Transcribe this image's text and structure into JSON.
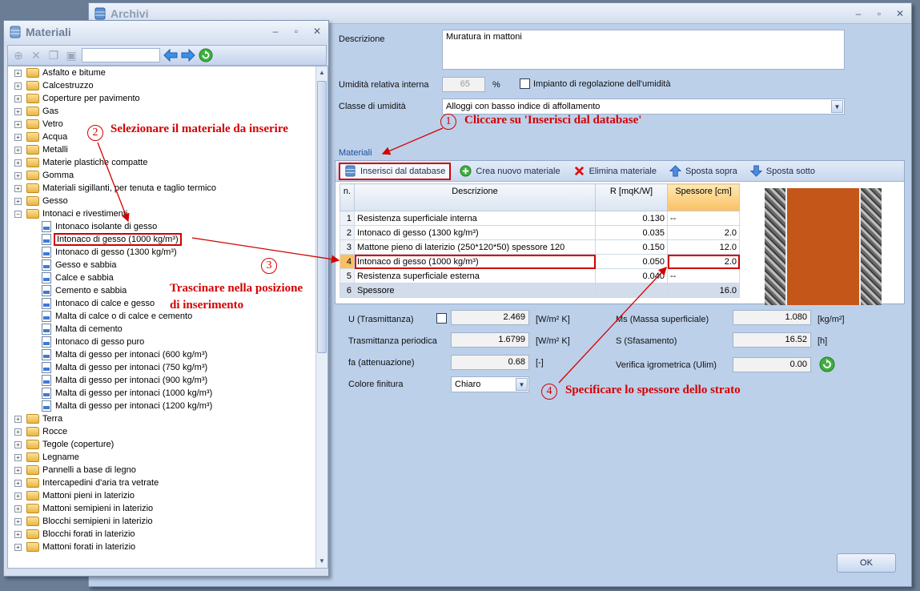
{
  "archivi": {
    "title": "Archivi",
    "descrizione_label": "Descrizione",
    "descrizione_value": "Muratura in mattoni",
    "umidita_label": "Umidità relativa interna",
    "umidita_value": "65",
    "umidita_unit": "%",
    "impianto_label": "Impianto di regolazione dell'umidità",
    "classe_label": "Classe di umidità",
    "classe_value": "Alloggi con basso indice di affollamento",
    "materiali_group": "Materiali",
    "toolbar": {
      "inserisci": "Inserisci dal database",
      "crea": "Crea nuovo materiale",
      "elimina": "Elimina materiale",
      "sopra": "Sposta sopra",
      "sotto": "Sposta sotto"
    },
    "table": {
      "headers": [
        "n.",
        "Descrizione",
        "R [mqK/W]",
        "Spessore [cm]"
      ],
      "rows": [
        {
          "n": "1",
          "desc": "Resistenza superficiale interna",
          "r": "0.130",
          "s": "--"
        },
        {
          "n": "2",
          "desc": "Intonaco di gesso (1300 kg/m³)",
          "r": "0.035",
          "s": "2.0"
        },
        {
          "n": "3",
          "desc": "Mattone pieno di laterizio (250*120*50) spessore 120",
          "r": "0.150",
          "s": "12.0"
        },
        {
          "n": "4",
          "desc": "Intonaco di gesso (1000 kg/m³)",
          "r": "0.050",
          "s": "2.0"
        },
        {
          "n": "5",
          "desc": "Resistenza superficiale esterna",
          "r": "0.040",
          "s": "--"
        }
      ],
      "total": {
        "n": "6",
        "desc": "Spessore",
        "r": "",
        "s": "16.0"
      }
    },
    "results": {
      "u_label": "U (Trasmittanza)",
      "u_value": "2.469",
      "u_unit": "[W/m² K]",
      "tp_label": "Trasmittanza periodica",
      "tp_value": "1.6799",
      "tp_unit": "[W/m² K]",
      "fa_label": "fa (attenuazione)",
      "fa_value": "0.68",
      "fa_unit": "[-]",
      "colore_label": "Colore finitura",
      "colore_value": "Chiaro",
      "ms_label": "Ms (Massa superficiale)",
      "ms_value": "1.080",
      "ms_unit": "[kg/m²]",
      "s_label": "S (Sfasamento)",
      "s_value": "16.52",
      "s_unit": "[h]",
      "verifica_label": "Verifica igrometrica (Ulim)",
      "verifica_value": "0.00"
    },
    "ok": "OK"
  },
  "materiali": {
    "title": "Materiali",
    "tree_top": [
      "Asfalto e bitume",
      "Calcestruzzo",
      "Coperture per pavimento",
      "Gas",
      "Vetro",
      "Acqua",
      "Metalli",
      "Materie plastiche compatte",
      "Gomma",
      "Materiali sigillanti, per tenuta e taglio termico",
      "Gesso",
      "Intonaci e rivestimenti"
    ],
    "tree_children": [
      "Intonaco isolante di gesso",
      "Intonaco di gesso (1000 kg/m³)",
      "Intonaco di gesso (1300 kg/m³)",
      "Gesso e sabbia",
      "Calce e sabbia",
      "Cemento e sabbia",
      "Intonaco di calce e gesso",
      "Malta di calce o di calce e cemento",
      "Malta di cemento",
      "Intonaco di gesso puro",
      "Malta di gesso per intonaci (600 kg/m³)",
      "Malta di gesso per intonaci (750 kg/m³)",
      "Malta di gesso per intonaci (900 kg/m³)",
      "Malta di gesso per intonaci (1000 kg/m³)",
      "Malta di gesso per intonaci (1200 kg/m³)"
    ],
    "tree_bottom": [
      "Terra",
      "Rocce",
      "Tegole (coperture)",
      "Legname",
      "Pannelli a base di legno",
      "Intercapedini d'aria tra vetrate",
      "Mattoni pieni in laterizio",
      "Mattoni semipieni in laterizio",
      "Blocchi semipieni in laterizio",
      "Blocchi forati in laterizio",
      "Mattoni forati in laterizio"
    ]
  },
  "annotations": {
    "a1_num": "1",
    "a1_text": "Cliccare su 'Inserisci dal database'",
    "a2_num": "2",
    "a2_text": "Selezionare il materiale da inserire",
    "a3_num": "3",
    "a3_text_1": "Trascinare nella posizione",
    "a3_text_2": "di inserimento",
    "a4_num": "4",
    "a4_text": "Specificare lo spessore dello strato"
  },
  "colors": {
    "annotation_red": "#d40000",
    "window_bg": "#bcd0ea",
    "brick": "#c4561a"
  }
}
